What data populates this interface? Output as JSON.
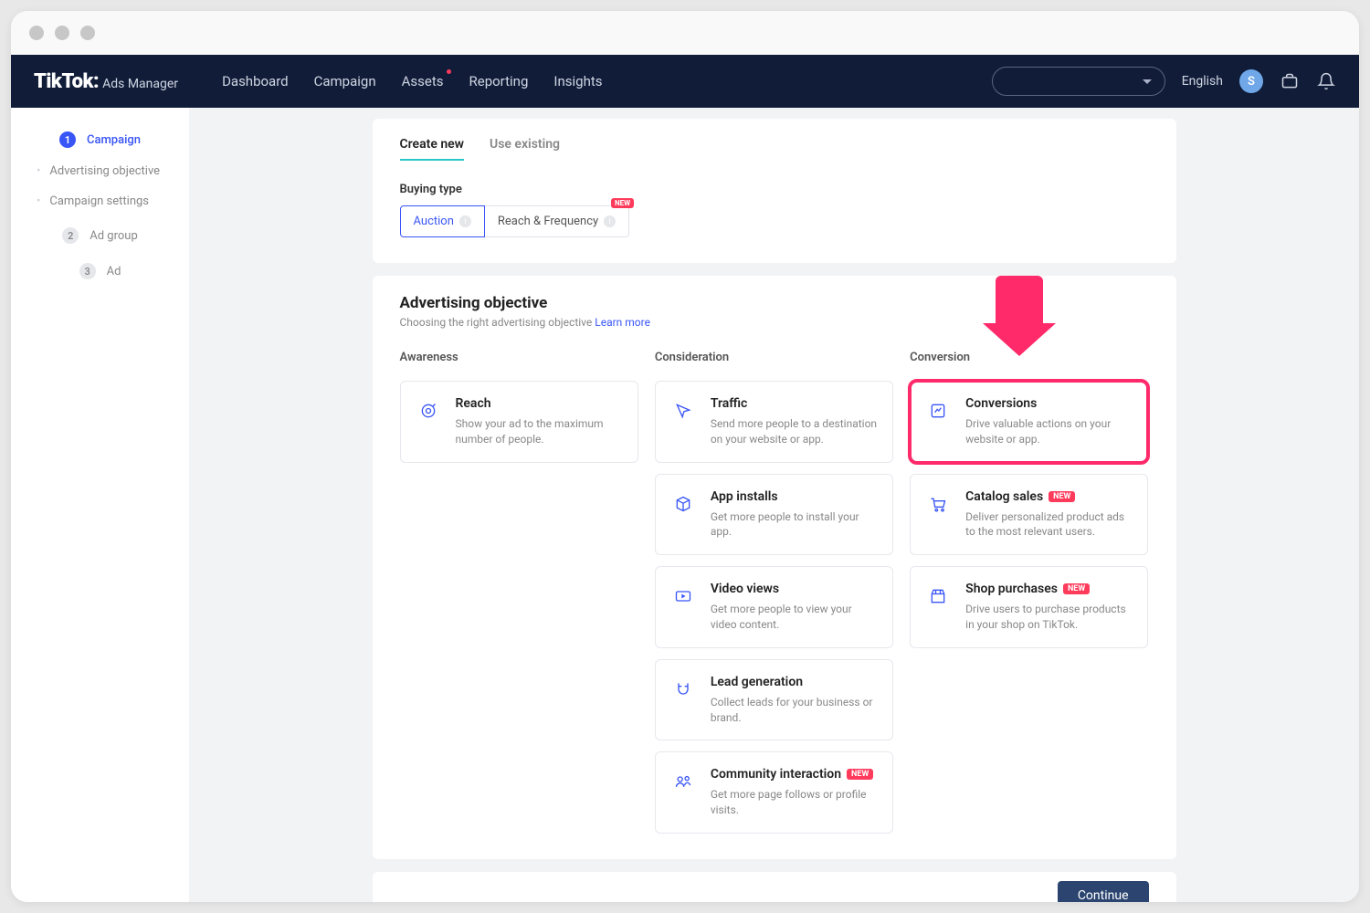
{
  "header": {
    "brand_main": "TikTok:",
    "brand_sub": "Ads Manager",
    "nav": {
      "dashboard": "Dashboard",
      "campaign": "Campaign",
      "assets": "Assets",
      "reporting": "Reporting",
      "insights": "Insights"
    },
    "lang": "English",
    "avatar_initial": "S"
  },
  "sidebar": {
    "step1_num": "1",
    "step1_label": "Campaign",
    "sub1": "Advertising objective",
    "sub2": "Campaign settings",
    "step2_num": "2",
    "step2_label": "Ad group",
    "step3_num": "3",
    "step3_label": "Ad"
  },
  "tabs": {
    "create_new": "Create new",
    "use_existing": "Use existing"
  },
  "buying_type": {
    "label": "Buying type",
    "auction": "Auction",
    "reach_freq": "Reach & Frequency",
    "new_badge": "NEW"
  },
  "objective": {
    "title": "Advertising objective",
    "subtitle": "Choosing the right advertising objective",
    "learn_more": "Learn more",
    "col_awareness": "Awareness",
    "col_consideration": "Consideration",
    "col_conversion": "Conversion",
    "reach": {
      "title": "Reach",
      "desc": "Show your ad to the maximum number of people."
    },
    "traffic": {
      "title": "Traffic",
      "desc": "Send more people to a destination on your website or app."
    },
    "app_installs": {
      "title": "App installs",
      "desc": "Get more people to install your app."
    },
    "video_views": {
      "title": "Video views",
      "desc": "Get more people to view your video content."
    },
    "lead_gen": {
      "title": "Lead generation",
      "desc": "Collect leads for your business or brand."
    },
    "community": {
      "title": "Community interaction",
      "desc": "Get more page follows or profile visits."
    },
    "conversions": {
      "title": "Conversions",
      "desc": "Drive valuable actions on your website or app."
    },
    "catalog": {
      "title": "Catalog sales",
      "desc": "Deliver personalized product ads to the most relevant users."
    },
    "shop": {
      "title": "Shop purchases",
      "desc": "Drive users to purchase products in your shop on TikTok."
    },
    "new_badge": "NEW"
  },
  "continue_label": "Continue"
}
